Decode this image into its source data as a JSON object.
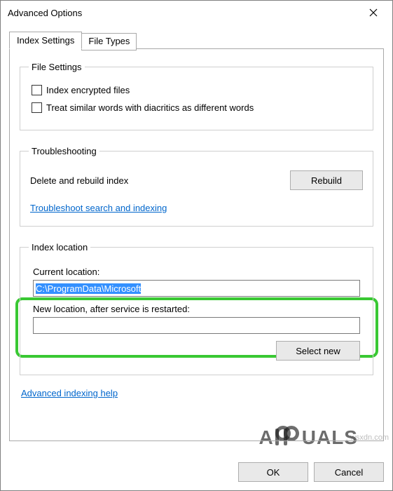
{
  "window": {
    "title": "Advanced Options"
  },
  "tabs": {
    "index_settings": "Index Settings",
    "file_types": "File Types"
  },
  "file_settings": {
    "legend": "File Settings",
    "encrypt": "Index encrypted files",
    "diacritics": "Treat similar words with diacritics as different words"
  },
  "troubleshooting": {
    "legend": "Troubleshooting",
    "delete_label": "Delete and rebuild index",
    "rebuild_btn": "Rebuild",
    "ts_link": "Troubleshoot search and indexing"
  },
  "index_location": {
    "legend": "Index location",
    "current_label": "Current location:",
    "current_value": "C:\\ProgramData\\Microsoft",
    "new_label": "New location, after service is restarted:",
    "new_value": "",
    "select_new_btn": "Select new"
  },
  "help_link": "Advanced indexing help",
  "buttons": {
    "ok": "OK",
    "cancel": "Cancel"
  },
  "watermark": "wsxdn.com",
  "brand_left": "A",
  "brand_right": "UALS"
}
